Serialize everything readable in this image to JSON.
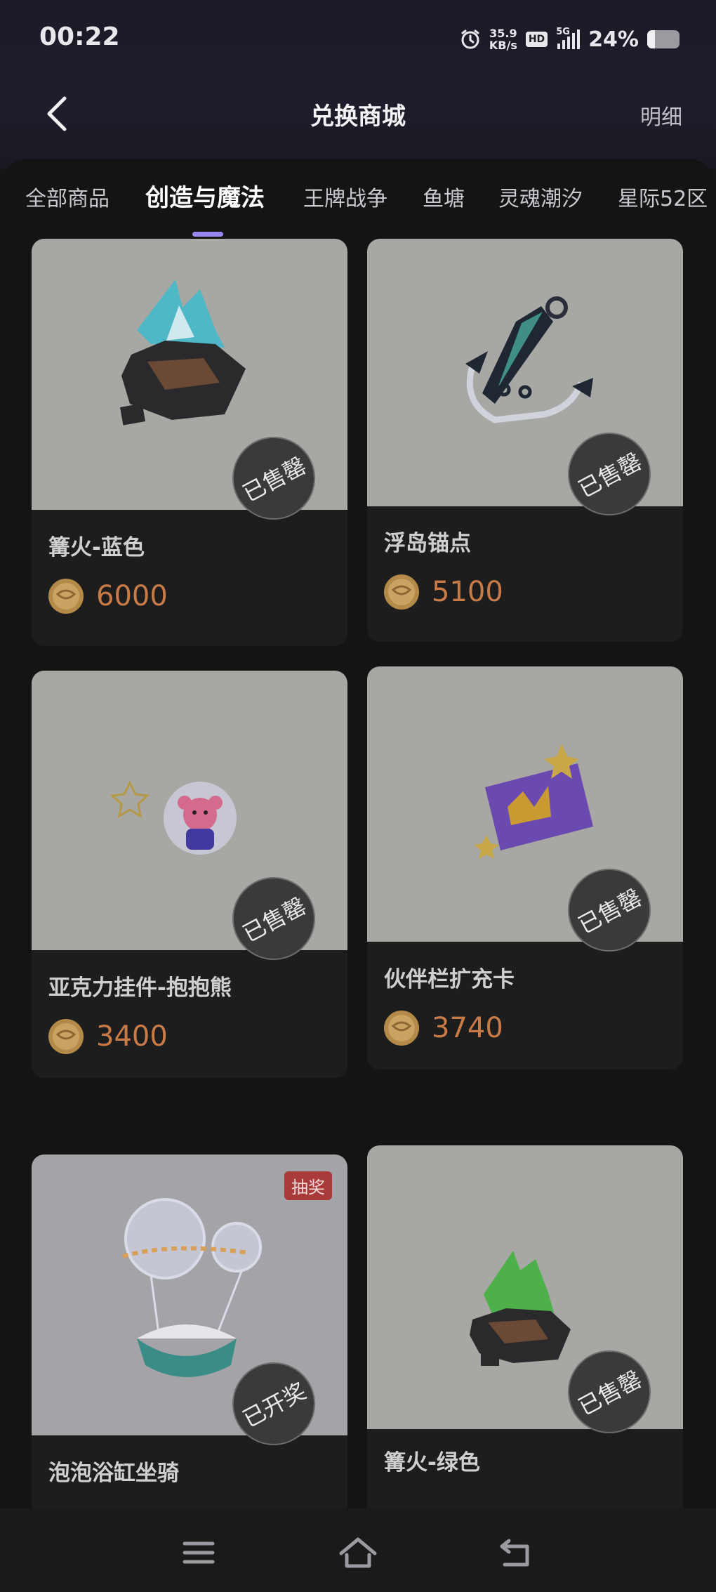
{
  "status": {
    "time": "00:22",
    "net_speed_value": "35.9",
    "net_speed_unit": "KB/s",
    "hd": "HD",
    "network": "5G",
    "battery": "24%",
    "battery_level": 0.24
  },
  "header": {
    "title": "兑换商城",
    "detail": "明细"
  },
  "tabs": [
    {
      "label": "全部商品"
    },
    {
      "label": "创造与魔法"
    },
    {
      "label": "王牌战争"
    },
    {
      "label": "鱼塘"
    },
    {
      "label": "灵魂潮汐"
    },
    {
      "label": "星际52区"
    }
  ],
  "active_tab": "创造与魔法",
  "products": [
    {
      "name": "篝火-蓝色",
      "price": "6000",
      "stamp": "已售罄"
    },
    {
      "name": "浮岛锚点",
      "price": "5100",
      "stamp": "已售罄"
    },
    {
      "name": "亚克力挂件-抱抱熊",
      "price": "3400",
      "stamp": "已售罄"
    },
    {
      "name": "伙伴栏扩充卡",
      "price": "3740",
      "stamp": "已售罄"
    },
    {
      "name": "泡泡浴缸坐骑",
      "price": "",
      "stamp": "已开奖",
      "tag": "抽奖"
    },
    {
      "name": "篝火-绿色",
      "price": "",
      "stamp": "已售罄"
    }
  ],
  "icons": {
    "back": "chevron-left-icon",
    "alarm": "alarm-icon",
    "coin": "coin-icon",
    "menu": "menu-icon",
    "home": "home-icon",
    "return": "return-icon"
  },
  "colors": {
    "accent": "#9a88f0",
    "price": "#c87b46",
    "lottery_tag": "#a83a3a"
  }
}
